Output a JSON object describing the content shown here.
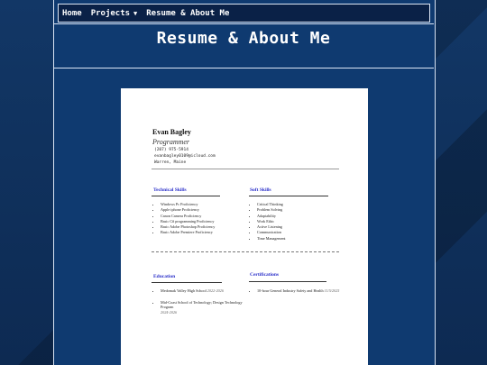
{
  "nav": {
    "items": [
      {
        "label": "Home"
      },
      {
        "label": "Projects",
        "has_dropdown": true
      },
      {
        "label": "Resume & About Me"
      }
    ]
  },
  "page_title": "Resume & About Me",
  "resume": {
    "name": "Evan Bagley",
    "role": "Programmer",
    "contact": [
      "(207) 975-5914",
      "evanbagley0109@icloud.com",
      "Warren, Maine"
    ],
    "technical_skills": {
      "title": "Technical Skills",
      "items": [
        "Windows Pc Proficiency",
        "Apple iphone Proficiency",
        "Canon Camera Proficiency",
        "Basic C# programming Proficiency",
        "Basic Adobe Photoshop Proficiency",
        "Basic Adobe Premiere Proficiency"
      ]
    },
    "soft_skills": {
      "title": "Soft Skills",
      "items": [
        "Critical Thinking",
        "Problem Solving",
        "Adaptability",
        "Work Ethic",
        "Active Listening",
        "Communication",
        "Time Management"
      ]
    },
    "education": {
      "title": "Education",
      "items": [
        {
          "text": "Medomak Valley High School",
          "dates": "2022-2026"
        },
        {
          "text": "Mid-Coast School of Technology; Design Technology Program",
          "dates": "2024-2026"
        }
      ]
    },
    "certifications": {
      "title": "Certifications",
      "items": [
        {
          "text": "10-hour General Industry Safety and Health",
          "dates": "11/5/2025"
        }
      ]
    }
  },
  "colors": {
    "background": "#0f2a4f",
    "frame": "#0f3a70",
    "nav": "#0a2147",
    "section_title": "#2a2fc9"
  }
}
